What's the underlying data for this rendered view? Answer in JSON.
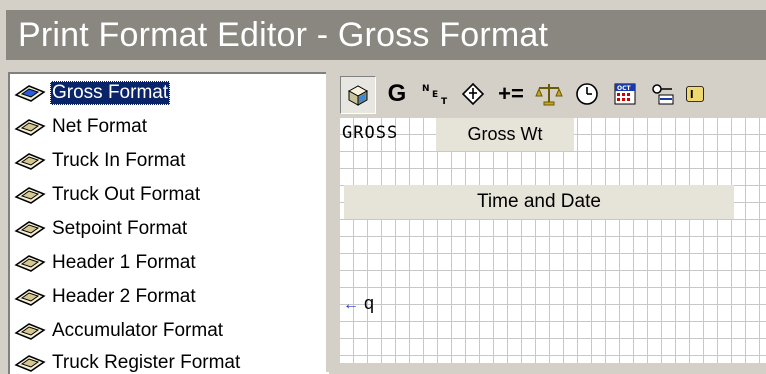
{
  "window": {
    "title": "Print Format Editor - Gross Format"
  },
  "tree": {
    "items": [
      {
        "label": "Gross Format",
        "selected": true
      },
      {
        "label": "Net Format"
      },
      {
        "label": "Truck In Format"
      },
      {
        "label": "Truck Out Format"
      },
      {
        "label": "Setpoint Format"
      },
      {
        "label": "Header 1 Format"
      },
      {
        "label": "Header 2 Format"
      },
      {
        "label": "Accumulator Format"
      },
      {
        "label": "Truck Register Format"
      }
    ]
  },
  "toolbar": {
    "buttons": [
      {
        "name": "select-tool",
        "icon": "cube-icon",
        "pressed": true
      },
      {
        "name": "gross-tool",
        "label": "G",
        "icon": "gross-letter-icon"
      },
      {
        "name": "net-tool",
        "label": "NET",
        "icon": "net-letters-icon"
      },
      {
        "name": "tare-tool",
        "icon": "diamond-icon"
      },
      {
        "name": "accumulate-tool",
        "label": "+=",
        "icon": "plus-equals-icon"
      },
      {
        "name": "scale-tool",
        "icon": "scales-icon"
      },
      {
        "name": "time-tool",
        "icon": "clock-icon"
      },
      {
        "name": "date-tool",
        "label": "OCT",
        "icon": "calendar-icon"
      },
      {
        "name": "setpoint-tool",
        "icon": "key-icon"
      },
      {
        "name": "more-tool",
        "icon": "label-icon"
      }
    ]
  },
  "canvas": {
    "fixed_text": "GROSS",
    "gross_field": "Gross Wt",
    "time_date_field": "Time and Date",
    "cursor_marker": "←",
    "cursor_char": "q"
  }
}
